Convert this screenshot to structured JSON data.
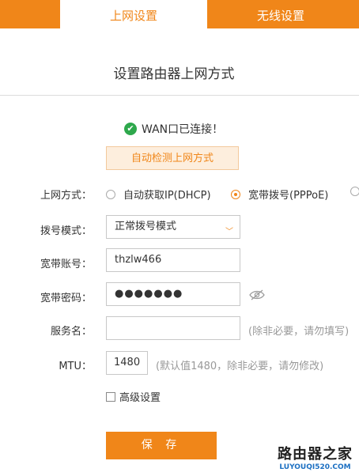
{
  "tabs": [
    {
      "label": "上网设置",
      "active": true
    },
    {
      "label": "无线设置",
      "active": false
    }
  ],
  "page_title": "设置路由器上网方式",
  "status": {
    "text": "WAN口已连接！",
    "icon": "check-circle-icon",
    "color": "#2ea84c"
  },
  "auto_detect_label": "自动检测上网方式",
  "connection_type": {
    "label": "上网方式：",
    "options": [
      {
        "label": "自动获取IP(DHCP)",
        "selected": false
      },
      {
        "label": "宽带拨号(PPPoE)",
        "selected": true
      }
    ]
  },
  "dial_mode": {
    "label": "拨号模式：",
    "value": "正常拨号模式"
  },
  "account": {
    "label": "宽带账号：",
    "value": "thzlw466"
  },
  "password": {
    "label": "宽带密码：",
    "masked_value": "●●●●●●●"
  },
  "service_name": {
    "label": "服务名：",
    "value": "",
    "hint": "(除非必要，请勿填写)"
  },
  "mtu": {
    "label": "MTU：",
    "value": "1480",
    "hint": "(默认值1480，除非必要，请勿修改)"
  },
  "advanced_label": "高级设置",
  "save_label": "保 存",
  "watermark": {
    "title": "路由器之家",
    "url": "LUYOUQI520.COM"
  },
  "colors": {
    "accent": "#f08619",
    "text": "#333333",
    "hint": "#999999"
  }
}
